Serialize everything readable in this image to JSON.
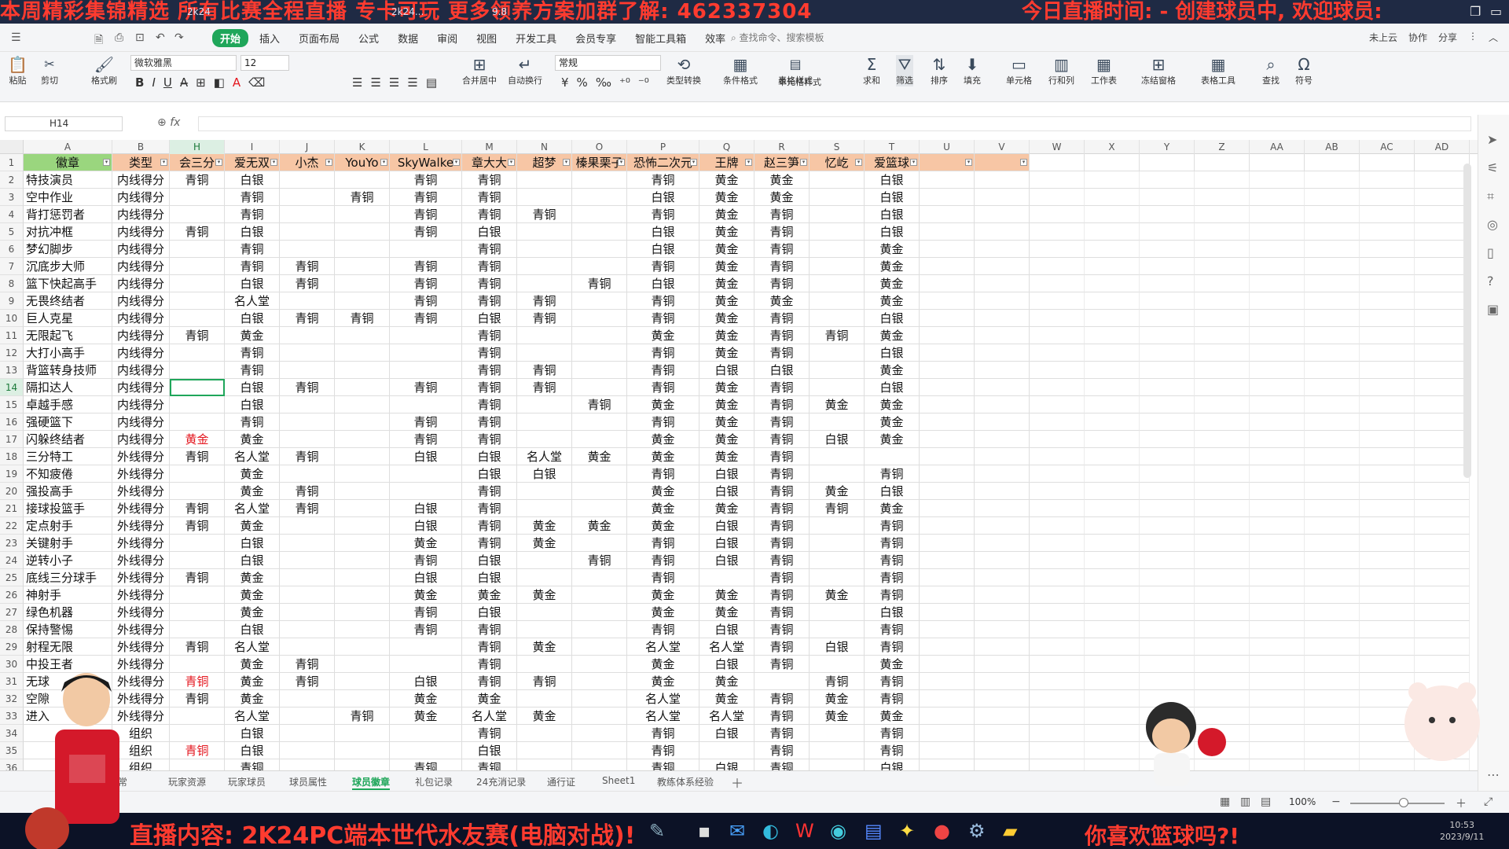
{
  "banner": {
    "text": "本周精彩集锦精选 所有比赛全程直播 专卡可玩 更多领养方案加群了解: 462337304",
    "doc_tab": "2k24",
    "doc_tab2": "2k24...",
    "version": "9.8",
    "live_time": "今日直播时间: -  创建球员中, 欢迎球员:"
  },
  "menu": {
    "tabs": [
      "开始",
      "插入",
      "页面布局",
      "公式",
      "数据",
      "审阅",
      "视图",
      "开发工具",
      "会员专享",
      "智能工具箱",
      "效率"
    ],
    "search": "查找命令、搜索模板",
    "right": [
      "未上云",
      "协作",
      "分享"
    ]
  },
  "ribbon": {
    "paste": "粘贴",
    "cut": "剪切",
    "format_painter": "格式刷",
    "font": "微软雅黑",
    "size": "12",
    "merge": "合并居中",
    "wrap": "自动换行",
    "numfmt": "常规",
    "type_convert": "类型转换",
    "cond_fmt": "条件格式",
    "table_style": "表格样式",
    "cell_style": "单元格样式",
    "sum": "求和",
    "filter": "筛选",
    "sort": "排序",
    "fill": "填充",
    "cell": "单元格",
    "rowcol": "行和列",
    "worksheet": "工作表",
    "freeze": "冻结窗格",
    "table_tools": "表格工具",
    "find": "查找",
    "symbol": "符号"
  },
  "formula": {
    "namebox": "H14",
    "fx": "fx",
    "value": ""
  },
  "columns": [
    "A",
    "B",
    "H",
    "I",
    "J",
    "K",
    "L",
    "M",
    "N",
    "O",
    "P",
    "Q",
    "R",
    "S",
    "T",
    "U",
    "V",
    "W",
    "X",
    "Y",
    "Z",
    "AA",
    "AB",
    "AC",
    "AD"
  ],
  "headers": [
    "徽章",
    "类型",
    "会三分",
    "爱无双",
    "小杰",
    "YouYo",
    "SkyWalke",
    "章大大",
    "超梦",
    "榛果栗子",
    "恐怖二次元",
    "王牌",
    "赵三笋",
    "忆屹",
    "爱篮球",
    "",
    ""
  ],
  "rows": [
    {
      "n": "2",
      "v": [
        "特技演员",
        "内线得分",
        "青铜",
        "白银",
        "",
        "",
        "青铜",
        "青铜",
        "",
        "",
        "青铜",
        "黄金",
        "黄金",
        "",
        "白银"
      ]
    },
    {
      "n": "3",
      "v": [
        "空中作业",
        "内线得分",
        "",
        "青铜",
        "",
        "青铜",
        "青铜",
        "青铜",
        "",
        "",
        "白银",
        "黄金",
        "黄金",
        "",
        "白银"
      ]
    },
    {
      "n": "4",
      "v": [
        "背打惩罚者",
        "内线得分",
        "",
        "青铜",
        "",
        "",
        "青铜",
        "青铜",
        "青铜",
        "",
        "青铜",
        "黄金",
        "青铜",
        "",
        "白银"
      ]
    },
    {
      "n": "5",
      "v": [
        "对抗冲框",
        "内线得分",
        "青铜",
        "白银",
        "",
        "",
        "青铜",
        "白银",
        "",
        "",
        "白银",
        "黄金",
        "青铜",
        "",
        "白银"
      ]
    },
    {
      "n": "6",
      "v": [
        "梦幻脚步",
        "内线得分",
        "",
        "青铜",
        "",
        "",
        "",
        "青铜",
        "",
        "",
        "白银",
        "黄金",
        "青铜",
        "",
        "黄金"
      ]
    },
    {
      "n": "7",
      "v": [
        "沉底步大师",
        "内线得分",
        "",
        "青铜",
        "青铜",
        "",
        "青铜",
        "青铜",
        "",
        "",
        "青铜",
        "黄金",
        "青铜",
        "",
        "黄金"
      ]
    },
    {
      "n": "8",
      "v": [
        "篮下快起高手",
        "内线得分",
        "",
        "白银",
        "青铜",
        "",
        "青铜",
        "青铜",
        "",
        "青铜",
        "白银",
        "黄金",
        "青铜",
        "",
        "黄金"
      ]
    },
    {
      "n": "9",
      "v": [
        "无畏终结者",
        "内线得分",
        "",
        "名人堂",
        "",
        "",
        "青铜",
        "青铜",
        "青铜",
        "",
        "青铜",
        "黄金",
        "黄金",
        "",
        "黄金"
      ]
    },
    {
      "n": "10",
      "v": [
        "巨人克星",
        "内线得分",
        "",
        "白银",
        "青铜",
        "青铜",
        "青铜",
        "白银",
        "青铜",
        "",
        "青铜",
        "黄金",
        "青铜",
        "",
        "白银"
      ]
    },
    {
      "n": "11",
      "v": [
        "无限起飞",
        "内线得分",
        "青铜",
        "黄金",
        "",
        "",
        "",
        "青铜",
        "",
        "",
        "黄金",
        "黄金",
        "青铜",
        "青铜",
        "黄金"
      ]
    },
    {
      "n": "12",
      "v": [
        "大打小高手",
        "内线得分",
        "",
        "青铜",
        "",
        "",
        "",
        "青铜",
        "",
        "",
        "青铜",
        "黄金",
        "青铜",
        "",
        "白银"
      ]
    },
    {
      "n": "13",
      "v": [
        "背篮转身技师",
        "内线得分",
        "",
        "青铜",
        "",
        "",
        "",
        "青铜",
        "青铜",
        "",
        "青铜",
        "白银",
        "白银",
        "",
        "黄金"
      ]
    },
    {
      "n": "14",
      "v": [
        "隔扣达人",
        "内线得分",
        "",
        "白银",
        "青铜",
        "",
        "青铜",
        "青铜",
        "青铜",
        "",
        "青铜",
        "黄金",
        "青铜",
        "",
        "白银"
      ]
    },
    {
      "n": "15",
      "v": [
        "卓越手感",
        "内线得分",
        "",
        "白银",
        "",
        "",
        "",
        "青铜",
        "",
        "青铜",
        "黄金",
        "黄金",
        "青铜",
        "黄金",
        "黄金"
      ]
    },
    {
      "n": "16",
      "v": [
        "强硬篮下",
        "内线得分",
        "",
        "青铜",
        "",
        "",
        "青铜",
        "青铜",
        "",
        "",
        "青铜",
        "黄金",
        "青铜",
        "",
        "黄金"
      ]
    },
    {
      "n": "17",
      "v": [
        "闪躲终结者",
        "内线得分",
        "黄金",
        "黄金",
        "",
        "",
        "青铜",
        "青铜",
        "",
        "",
        "黄金",
        "黄金",
        "青铜",
        "白银",
        "黄金"
      ]
    },
    {
      "n": "18",
      "v": [
        "三分特工",
        "外线得分",
        "青铜",
        "名人堂",
        "青铜",
        "",
        "白银",
        "白银",
        "名人堂",
        "黄金",
        "黄金",
        "黄金",
        "青铜",
        "",
        ""
      ]
    },
    {
      "n": "19",
      "v": [
        "不知疲倦",
        "外线得分",
        "",
        "黄金",
        "",
        "",
        "",
        "白银",
        "白银",
        "",
        "青铜",
        "白银",
        "青铜",
        "",
        "青铜"
      ]
    },
    {
      "n": "20",
      "v": [
        "强投高手",
        "外线得分",
        "",
        "黄金",
        "青铜",
        "",
        "",
        "青铜",
        "",
        "",
        "黄金",
        "白银",
        "青铜",
        "黄金",
        "白银"
      ]
    },
    {
      "n": "21",
      "v": [
        "接球投篮手",
        "外线得分",
        "青铜",
        "名人堂",
        "青铜",
        "",
        "白银",
        "青铜",
        "",
        "",
        "黄金",
        "黄金",
        "青铜",
        "青铜",
        "黄金"
      ]
    },
    {
      "n": "22",
      "v": [
        "定点射手",
        "外线得分",
        "青铜",
        "黄金",
        "",
        "",
        "白银",
        "青铜",
        "黄金",
        "黄金",
        "黄金",
        "白银",
        "青铜",
        "",
        "青铜"
      ]
    },
    {
      "n": "23",
      "v": [
        "关键射手",
        "外线得分",
        "",
        "白银",
        "",
        "",
        "黄金",
        "青铜",
        "黄金",
        "",
        "青铜",
        "白银",
        "青铜",
        "",
        "青铜"
      ]
    },
    {
      "n": "24",
      "v": [
        "逆转小子",
        "外线得分",
        "",
        "白银",
        "",
        "",
        "青铜",
        "白银",
        "",
        "青铜",
        "青铜",
        "白银",
        "青铜",
        "",
        "青铜"
      ]
    },
    {
      "n": "25",
      "v": [
        "底线三分球手",
        "外线得分",
        "青铜",
        "黄金",
        "",
        "",
        "白银",
        "白银",
        "",
        "",
        "青铜",
        "",
        "青铜",
        "",
        "青铜"
      ]
    },
    {
      "n": "26",
      "v": [
        "神射手",
        "外线得分",
        "",
        "黄金",
        "",
        "",
        "黄金",
        "黄金",
        "黄金",
        "",
        "黄金",
        "黄金",
        "青铜",
        "黄金",
        "青铜"
      ]
    },
    {
      "n": "27",
      "v": [
        "绿色机器",
        "外线得分",
        "",
        "黄金",
        "",
        "",
        "青铜",
        "白银",
        "",
        "",
        "黄金",
        "黄金",
        "青铜",
        "",
        "白银"
      ]
    },
    {
      "n": "28",
      "v": [
        "保持警惕",
        "外线得分",
        "",
        "白银",
        "",
        "",
        "青铜",
        "青铜",
        "",
        "",
        "青铜",
        "白银",
        "青铜",
        "",
        "青铜"
      ]
    },
    {
      "n": "29",
      "v": [
        "射程无限",
        "外线得分",
        "青铜",
        "名人堂",
        "",
        "",
        "",
        "青铜",
        "黄金",
        "",
        "名人堂",
        "名人堂",
        "青铜",
        "白银",
        "青铜"
      ]
    },
    {
      "n": "30",
      "v": [
        "中投王者",
        "外线得分",
        "",
        "黄金",
        "青铜",
        "",
        "",
        "青铜",
        "",
        "",
        "黄金",
        "白银",
        "青铜",
        "",
        "黄金"
      ]
    },
    {
      "n": "31",
      "v": [
        "无球",
        "外线得分",
        "青铜",
        "黄金",
        "青铜",
        "",
        "白银",
        "青铜",
        "青铜",
        "",
        "黄金",
        "黄金",
        "",
        "青铜",
        "青铜"
      ]
    },
    {
      "n": "32",
      "v": [
        "空隙",
        "外线得分",
        "青铜",
        "黄金",
        "",
        "",
        "黄金",
        "黄金",
        "",
        "",
        "名人堂",
        "黄金",
        "青铜",
        "黄金",
        "青铜"
      ]
    },
    {
      "n": "33",
      "v": [
        "进入",
        "外线得分",
        "",
        "名人堂",
        "",
        "青铜",
        "黄金",
        "名人堂",
        "黄金",
        "",
        "名人堂",
        "名人堂",
        "青铜",
        "黄金",
        "黄金"
      ]
    },
    {
      "n": "34",
      "v": [
        "",
        "组织",
        "",
        "白银",
        "",
        "",
        "",
        "青铜",
        "",
        "",
        "青铜",
        "白银",
        "青铜",
        "",
        "青铜"
      ]
    },
    {
      "n": "35",
      "v": [
        "",
        "组织",
        "青铜",
        "白银",
        "",
        "",
        "",
        "白银",
        "",
        "",
        "青铜",
        "",
        "青铜",
        "",
        "青铜"
      ]
    },
    {
      "n": "36",
      "v": [
        "",
        "组织",
        "",
        "青铜",
        "",
        "",
        "青铜",
        "青铜",
        "",
        "",
        "青铜",
        "白银",
        "青铜",
        "",
        "白银"
      ]
    }
  ],
  "red_cells": [
    [
      "17",
      2
    ],
    [
      "31",
      2
    ],
    [
      "35",
      2
    ]
  ],
  "sheets": [
    "常",
    "玩家资源",
    "玩家球员",
    "球员属性",
    "球员徽章",
    "礼包记录",
    "24充消记录",
    "通行证",
    "Sheet1",
    "教练体系经验"
  ],
  "active_sheet": "球员徽章",
  "zoom": "100%",
  "bottom": {
    "content": "直播内容: 2K24PC端本世代水友赛(电脑对战)!",
    "ask": "你喜欢篮球吗?!",
    "clock_time": "10:53",
    "clock_date": "2023/9/11"
  },
  "colors": {
    "header_green": "#9ad67e",
    "header_orange": "#f7c6a5",
    "accent": "#1fa65a",
    "banner_red": "#ff3b2f",
    "cell_red": "#e4161e"
  }
}
